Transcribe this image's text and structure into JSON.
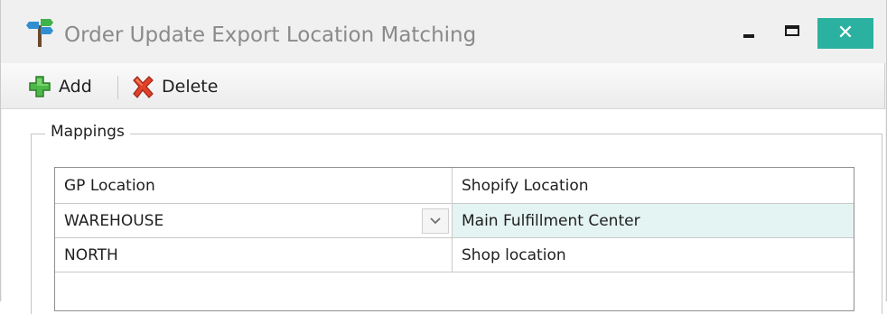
{
  "window": {
    "title": "Order Update Export Location Matching",
    "close_symbol": "✕",
    "accent_color": "#2bb1a0"
  },
  "toolbar": {
    "add_label": "Add",
    "delete_label": "Delete",
    "add_icon": "green-plus-icon",
    "delete_icon": "red-x-icon"
  },
  "mappings": {
    "legend": "Mappings",
    "columns": [
      "GP Location",
      "Shopify Location"
    ],
    "rows": [
      {
        "gp_location": "WAREHOUSE",
        "shopify_location": "Main Fulfillment Center",
        "selected": true
      },
      {
        "gp_location": "NORTH",
        "shopify_location": "Shop location",
        "selected": false
      }
    ],
    "dropdown_icon": "chevron-down-icon"
  }
}
